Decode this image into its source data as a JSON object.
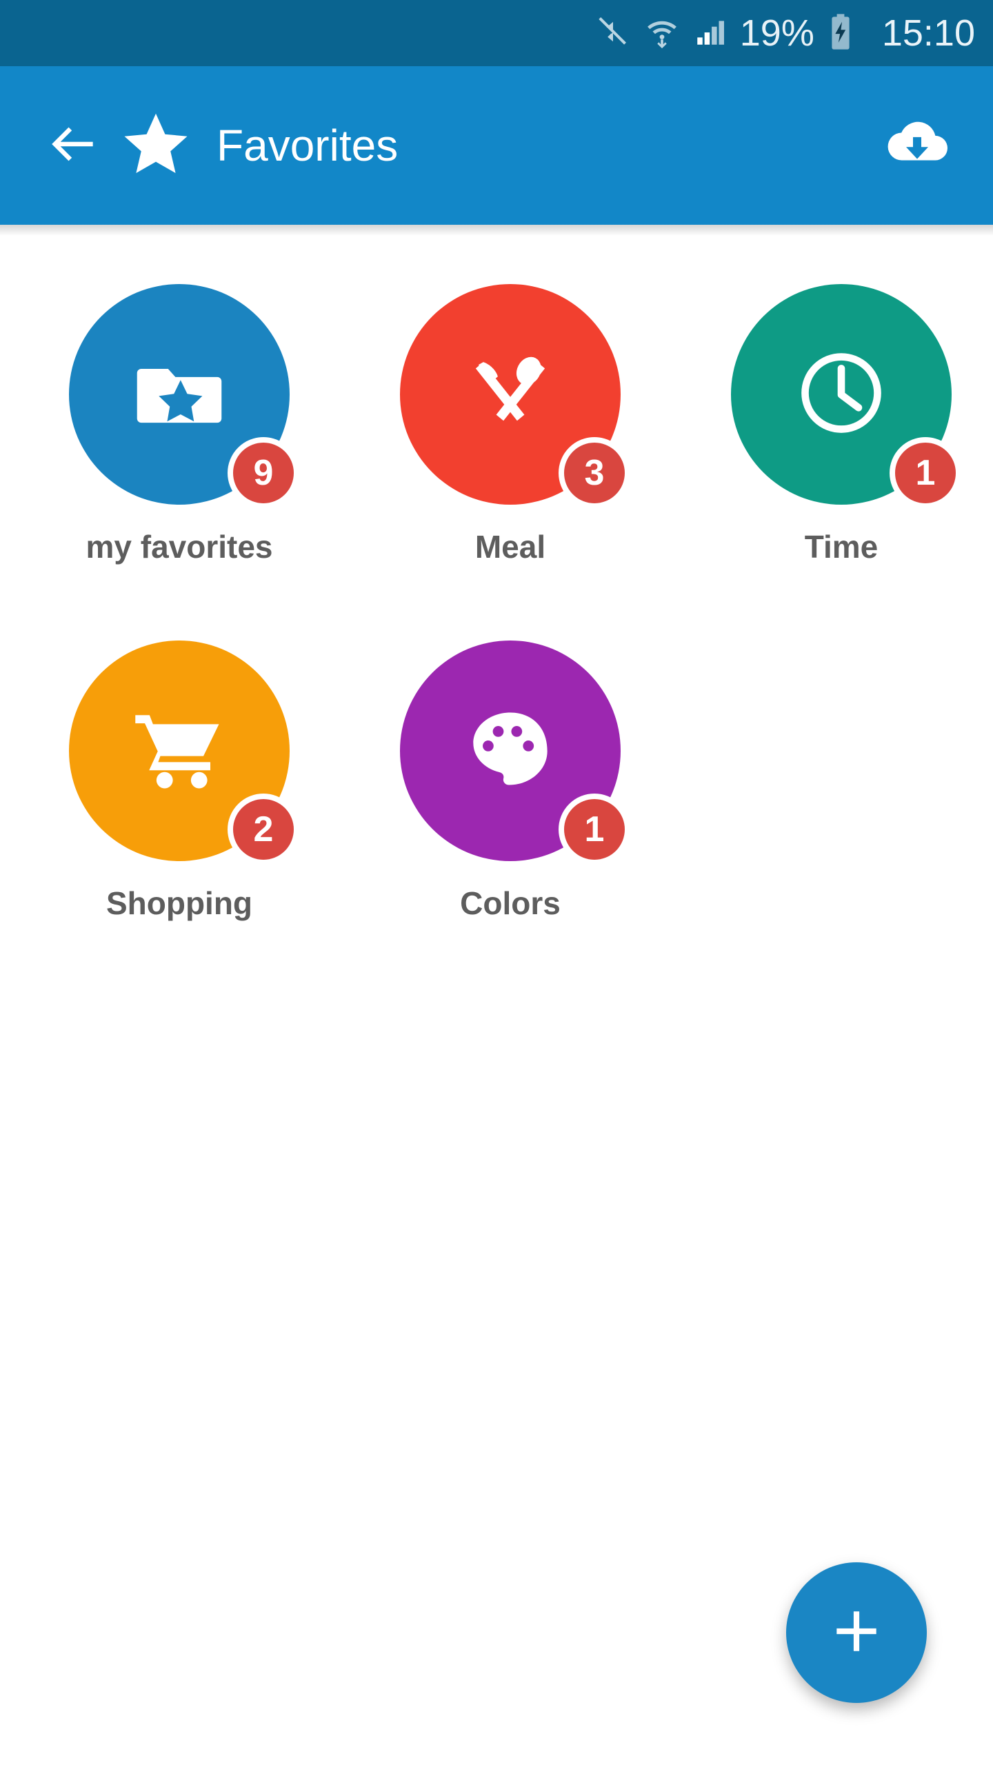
{
  "status_bar": {
    "battery_percent": "19%",
    "clock": "15:10",
    "icons": [
      "mute-icon",
      "wifi-icon",
      "signal-icon",
      "battery-charging-icon"
    ],
    "background_color": "#0a6490"
  },
  "app_bar": {
    "title": "Favorites",
    "back_icon": "back-arrow-icon",
    "leading_icon": "star-icon",
    "action_icon": "cloud-download-icon",
    "background_color": "#1287c8"
  },
  "grid": {
    "items": [
      {
        "label": "my favorites",
        "badge": "9",
        "color": "#1b84c0",
        "icon": "folder-star-icon"
      },
      {
        "label": "Meal",
        "badge": "3",
        "color": "#f2402f",
        "icon": "cutlery-icon"
      },
      {
        "label": "Time",
        "badge": "1",
        "color": "#0e9b85",
        "icon": "clock-icon"
      },
      {
        "label": "Shopping",
        "badge": "2",
        "color": "#f79e09",
        "icon": "shopping-cart-icon"
      },
      {
        "label": "Colors",
        "badge": "1",
        "color": "#9c27b0",
        "icon": "palette-icon"
      }
    ],
    "badge_color": "#d9463f",
    "label_color": "#5d5d5d"
  },
  "fab": {
    "icon": "plus-icon",
    "color": "#1a86c4"
  }
}
